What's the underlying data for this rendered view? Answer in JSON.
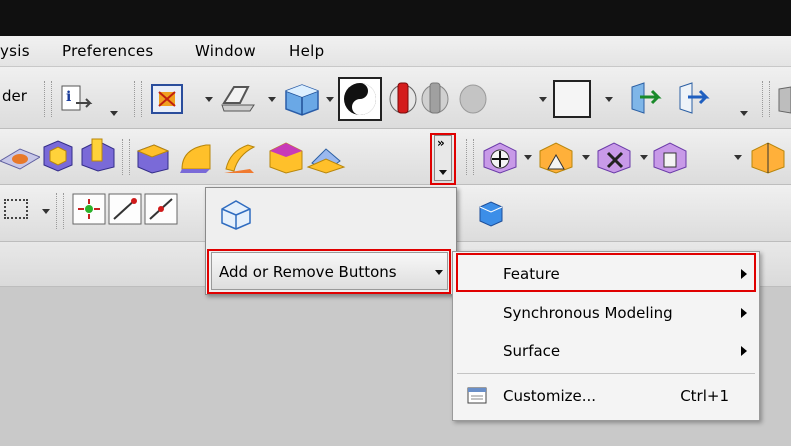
{
  "menubar": {
    "items": [
      "ysis",
      "Preferences",
      "Window",
      "Help"
    ]
  },
  "toolbar": {
    "left_label": "der"
  },
  "popup": {
    "add_remove_label": "Add or Remove Buttons"
  },
  "submenu": {
    "items": [
      {
        "label": "Feature",
        "has_submenu": true
      },
      {
        "label": "Synchronous Modeling",
        "has_submenu": true
      },
      {
        "label": "Surface",
        "has_submenu": true
      },
      {
        "label": "Customize...",
        "shortcut": "Ctrl+1",
        "has_submenu": false
      }
    ]
  },
  "colors": {
    "highlight": "#e00000",
    "titlebar": "#101010"
  }
}
